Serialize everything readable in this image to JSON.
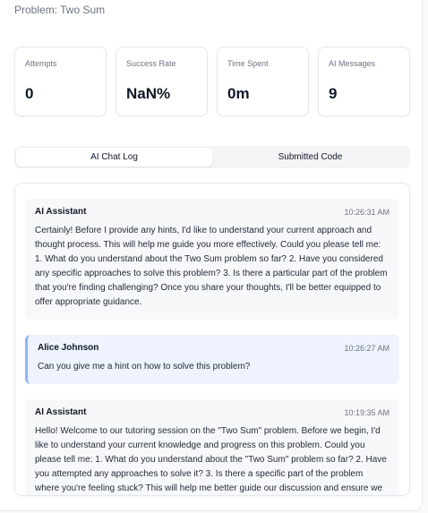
{
  "problem": {
    "title": "Problem: Two Sum"
  },
  "stats": [
    {
      "label": "Attempts",
      "value": "0"
    },
    {
      "label": "Success Rate",
      "value": "NaN%"
    },
    {
      "label": "Time Spent",
      "value": "0m"
    },
    {
      "label": "AI Messages",
      "value": "9"
    }
  ],
  "tabs": [
    {
      "label": "AI Chat Log",
      "active": true
    },
    {
      "label": "Submitted Code",
      "active": false
    }
  ],
  "messages": [
    {
      "sender": "AI Assistant",
      "time": "10:26:31 AM",
      "role": "assistant",
      "text": "Certainly! Before I provide any hints, I'd like to understand your current approach and thought process. This will help me guide you more effectively. Could you please tell me: 1. What do you understand about the Two Sum problem so far? 2. Have you considered any specific approaches to solve this problem? 3. Is there a particular part of the problem that you're finding challenging? Once you share your thoughts, I'll be better equipped to offer appropriate guidance."
    },
    {
      "sender": "Alice Johnson",
      "time": "10:26:27 AM",
      "role": "user",
      "text": "Can you give me a hint on how to solve this problem?"
    },
    {
      "sender": "AI Assistant",
      "time": "10:19:35 AM",
      "role": "assistant",
      "text": "Hello! Welcome to our tutoring session on the \"Two Sum\" problem. Before we begin, I'd like to understand your current knowledge and progress on this problem. Could you please tell me: 1. What do you understand about the \"Two Sum\" problem so far? 2. Have you attempted any approaches to solve it? 3. Is there a specific part of the problem where you're feeling stuck? This will help me better guide our discussion and ensure we focus on the areas where you need the most support."
    }
  ]
}
